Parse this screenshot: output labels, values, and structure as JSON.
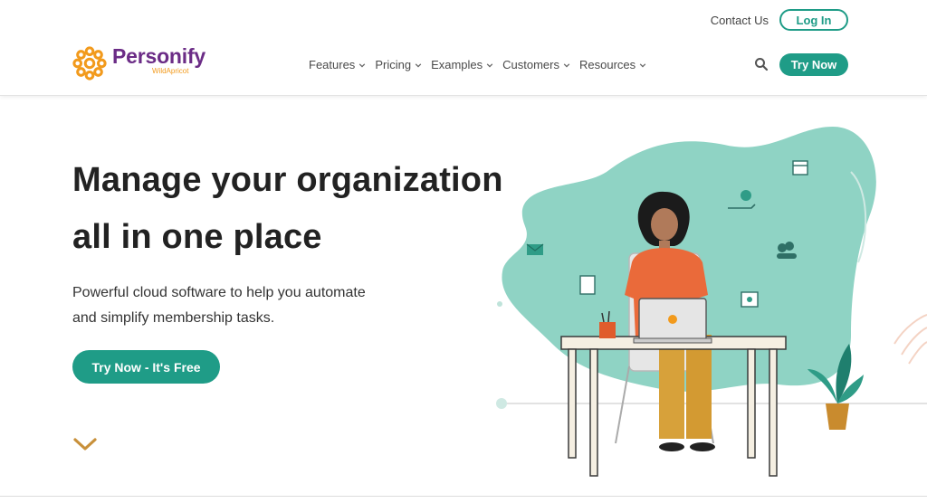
{
  "header": {
    "contact_label": "Contact Us",
    "login_label": "Log In",
    "try_now_label": "Try Now",
    "logo": {
      "name": "Personify",
      "sub": "WildApricot"
    },
    "nav": [
      {
        "label": "Features"
      },
      {
        "label": "Pricing"
      },
      {
        "label": "Examples"
      },
      {
        "label": "Customers"
      },
      {
        "label": "Resources"
      }
    ],
    "search_icon": "search-icon"
  },
  "hero": {
    "title_line1": "Manage your organization",
    "title_line2": "all in one place",
    "subtitle_line1": "Powerful cloud software to help you automate",
    "subtitle_line2": "and simplify membership tasks.",
    "cta_label": "Try Now - It's Free",
    "scroll_icon": "chevron-down-icon"
  },
  "colors": {
    "brand_purple": "#6b2c86",
    "brand_orange": "#f29a1c",
    "accent_teal": "#1f9c87",
    "blob_teal": "#8fd3c4"
  }
}
